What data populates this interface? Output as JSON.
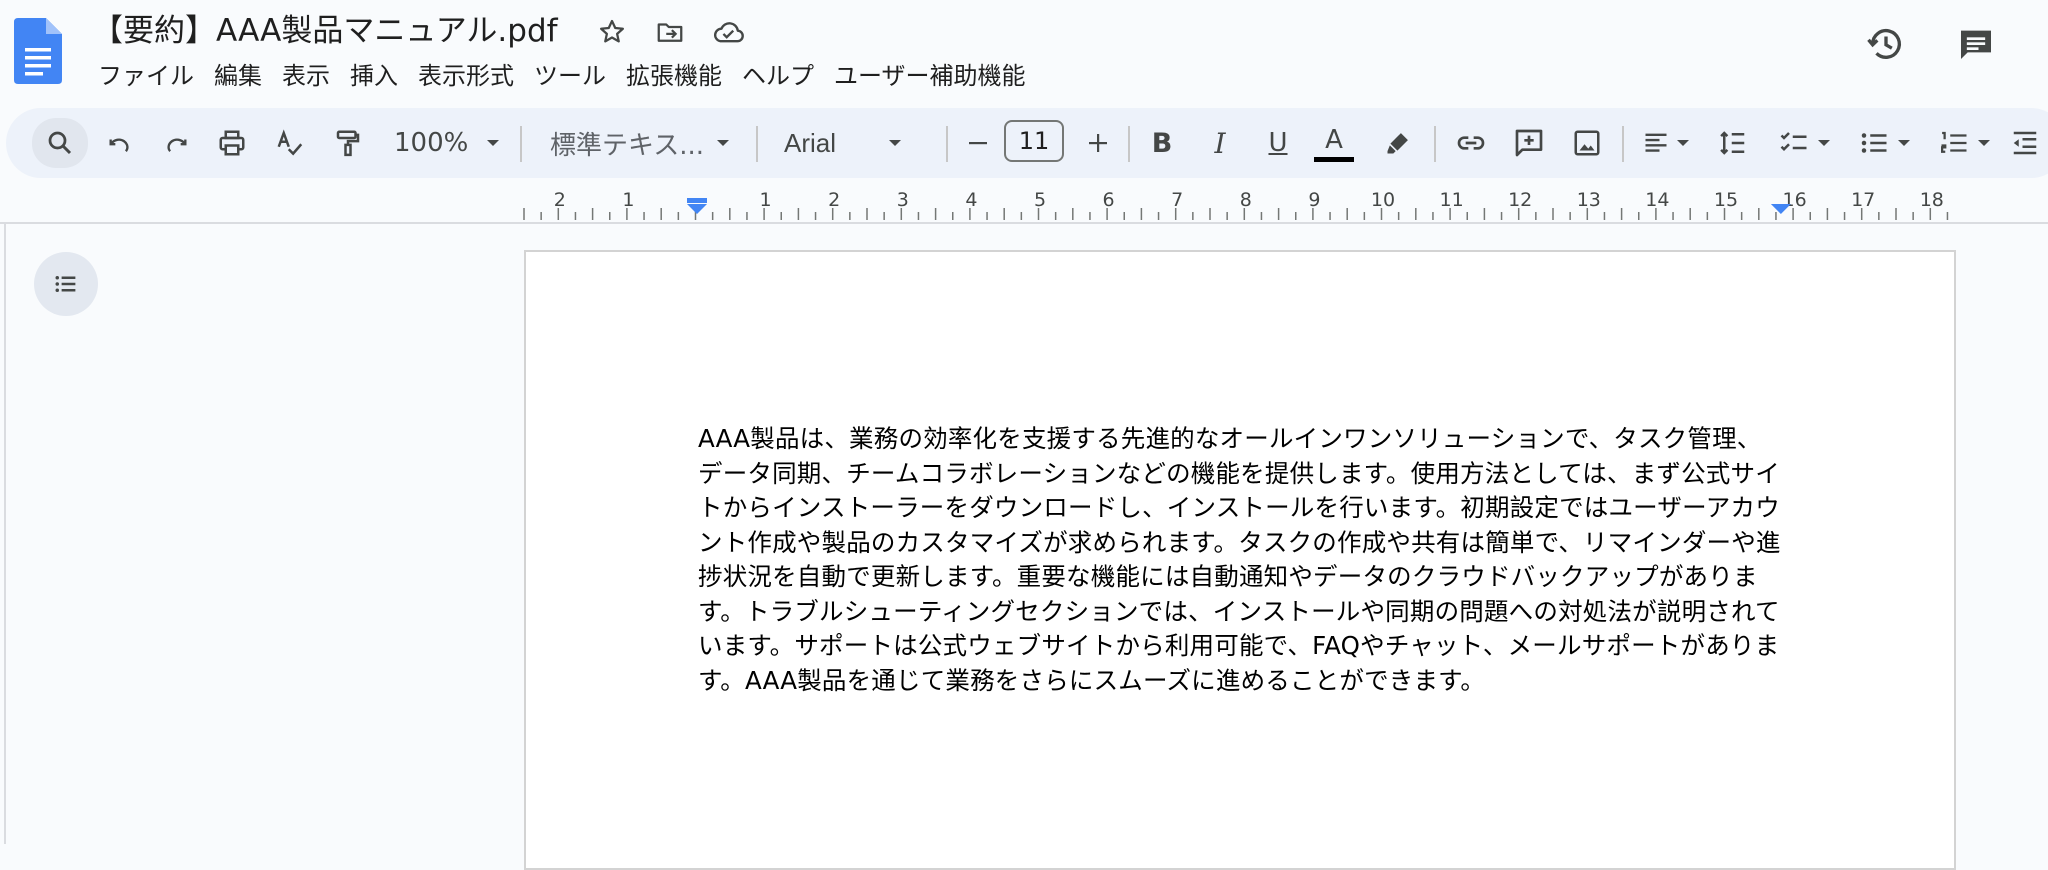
{
  "document": {
    "title": "【要約】AAA製品マニュアル.pdf",
    "body": "AAA製品は、業務の効率化を支援する先進的なオールインワンソリューションで、タスク管理、データ同期、チームコラボレーションなどの機能を提供します。使用方法としては、まず公式サイトからインストーラーをダウンロードし、インストールを行います。初期設定ではユーザーアカウント作成や製品のカスタマイズが求められます。タスクの作成や共有は簡単で、リマインダーや進捗状況を自動で更新します。重要な機能には自動通知やデータのクラウドバックアップがあります。トラブルシューティングセクションでは、インストールや同期の問題への対処法が説明されています。サポートは公式ウェブサイトから利用可能で、FAQやチャット、メールサポートがあります。AAA製品を通じて業務をさらにスムーズに進めることができます。"
  },
  "menu": [
    "ファイル",
    "編集",
    "表示",
    "挿入",
    "表示形式",
    "ツール",
    "拡張機能",
    "ヘルプ",
    "ユーザー補助機能"
  ],
  "toolbar": {
    "zoom": "100%",
    "style": "標準テキス...",
    "font": "Arial",
    "font_size": "11",
    "bold": "B",
    "italic": "I",
    "underline": "U",
    "text_color_letter": "A"
  },
  "ruler": {
    "labels": [
      "2",
      "1",
      "1",
      "2",
      "3",
      "4",
      "5",
      "6",
      "7",
      "8",
      "9",
      "10",
      "11",
      "12",
      "13",
      "14",
      "15",
      "16",
      "17",
      "18"
    ]
  },
  "colors": {
    "accent": "#4285f4",
    "toolbar_bg": "#edf2fa",
    "page_bg": "#f9fbfd"
  }
}
